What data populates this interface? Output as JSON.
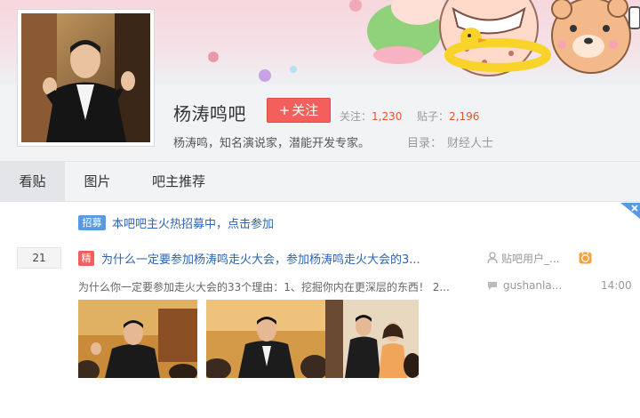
{
  "forum": {
    "name": "杨涛鸣吧",
    "follow_label": "关注",
    "follow_plus": "+",
    "followers_label": "关注：",
    "followers_count": "1,230",
    "posts_label": "贴子：",
    "posts_count": "2,196",
    "description": "杨涛鸣，知名演说家，潜能开发专家。",
    "catalog_label": "目录：",
    "catalog_value": "财经人士"
  },
  "tabs": [
    {
      "label": "看贴",
      "active": true
    },
    {
      "label": "图片",
      "active": false
    },
    {
      "label": "吧主推荐",
      "active": false
    }
  ],
  "notice": {
    "badge": "招募",
    "text": "本吧吧主火热招募中，点击参加"
  },
  "thread": {
    "reply_count": "21",
    "badge": "精",
    "title": "为什么一定要参加杨涛鸣走火大会，参加杨涛鸣走火大会的3...",
    "author": "贴吧用户_...",
    "abstract": "为什么你一定要参加走火大会的33个理由：1、挖掘你内在更深层的东西！ 2...",
    "last_reply_user": "gushanla...",
    "last_reply_time": "14:00",
    "thumbnails": [
      "photo-1",
      "photo-2",
      "photo-3"
    ]
  },
  "colors": {
    "accent_red": "#f25f5c",
    "link_blue": "#2d64b3",
    "count_orange": "#e0562c",
    "badge_blue": "#5a9be0"
  },
  "icons": {
    "author": "user-icon",
    "reply": "comment-icon",
    "tag": "orange-badge-icon",
    "corner": "close-corner-icon"
  }
}
